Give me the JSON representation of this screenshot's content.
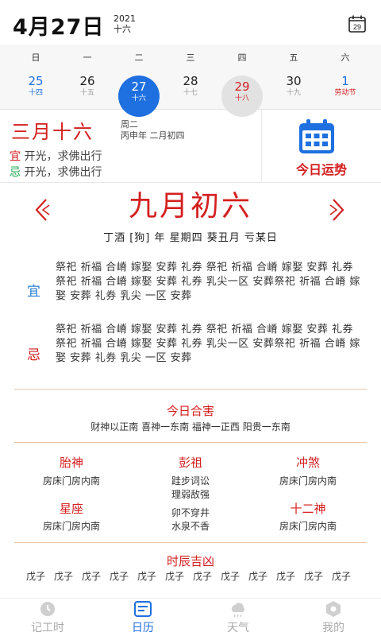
{
  "header": {
    "date": "4月27日",
    "year": "2021",
    "lunar_day": "十六",
    "calendar_button_day": "29"
  },
  "week": {
    "labels": [
      "日",
      "一",
      "二",
      "三",
      "四",
      "五",
      "六"
    ],
    "days": [
      {
        "num": "25",
        "sub": "十四",
        "state": "blue"
      },
      {
        "num": "26",
        "sub": "十五",
        "state": "normal"
      },
      {
        "num": "27",
        "sub": "十六",
        "state": "selected"
      },
      {
        "num": "28",
        "sub": "十七",
        "state": "normal"
      },
      {
        "num": "29",
        "sub": "十八",
        "state": "today"
      },
      {
        "num": "30",
        "sub": "十九",
        "state": "normal"
      },
      {
        "num": "1",
        "sub": "劳动节",
        "state": "holiday"
      }
    ]
  },
  "lunar": {
    "big": "三月十六",
    "weekday": "周二",
    "ganzhi": "丙申年 二月初四",
    "yi_tag": "宜",
    "yi_text": "开光，求佛出行",
    "ji_tag": "忌",
    "ji_text": "开光，求佛出行"
  },
  "fortune": {
    "label": "今日运势"
  },
  "detail": {
    "date": "九月初六",
    "ganzhi": "丁酒 [狗] 年  星期四  葵丑月  亏某日",
    "yi_label": "宜",
    "yi_text": "祭祀 祈福 合嵴 嫁娶 安葬 礼券 祭祀 祈福 合嵴 嫁娶 安葬 礼券 祭祀 祈福 合嵴 嫁娶 安葬 礼券 乳尖一区 安葬祭祀 祈福 合嵴 嫁娶 安葬 礼券 乳尖 一区 安葬",
    "ji_label": "忌",
    "ji_text": "祭祀 祈福 合嵴 嫁娶 安葬 礼券 祭祀 祈福 合嵴 嫁娶 安葬 礼券 祭祀 祈福 合嵴 嫁娶 安葬 礼券 乳尖一区 安葬祭祀 祈福 合嵴 嫁娶 安葬 礼券 乳尖 一区 安葬"
  },
  "harmony": {
    "title": "今日合害",
    "gods": "财神以正南 喜神一东南 福神一正西 阳贵一东南"
  },
  "grid": {
    "taishen_title": "胎神",
    "taishen_text": "房床门房内南",
    "pengzu_title": "彭祖",
    "pengzu_text1": "跬步词讼",
    "pengzu_text2": "理弱敌强",
    "chongsha_title": "冲煞",
    "chongsha_text": "房床门房内南",
    "xingzuo_title": "星座",
    "xingzuo_text": "房床门房内南",
    "pengzu_text3": "卯不穿井",
    "pengzu_text4": "水泉不香",
    "shier_title": "十二神",
    "shier_text": "房床门房内南"
  },
  "hours": {
    "title": "时辰吉凶",
    "items": [
      "戊子",
      "戊子",
      "戊子",
      "戊子",
      "戊子",
      "戊子",
      "戊子",
      "戊子",
      "戊子",
      "戊子",
      "戊子",
      "戊子"
    ]
  },
  "tabs": [
    {
      "label": "记工时",
      "icon": "clock-icon",
      "active": false
    },
    {
      "label": "日历",
      "icon": "calendar-icon",
      "active": true
    },
    {
      "label": "天气",
      "icon": "weather-icon",
      "active": false
    },
    {
      "label": "我的",
      "icon": "profile-icon",
      "active": false
    }
  ],
  "colors": {
    "accent_red": "#d42020",
    "accent_blue": "#1e6fe0",
    "ji_green": "#19a84a",
    "yi_blue": "#2a7fd4"
  }
}
